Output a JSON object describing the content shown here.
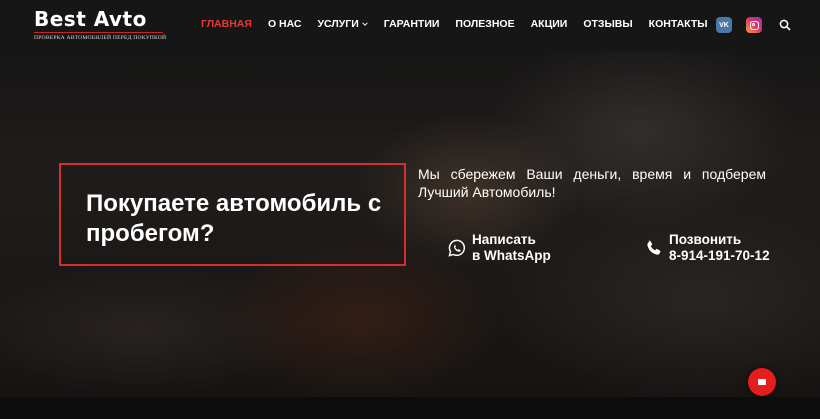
{
  "header": {
    "logo_title": "Best Avto",
    "logo_subtitle": "ПРОВЕРКА АВТОМОБИЛЕЙ ПЕРЕД ПОКУПКОЙ",
    "nav": [
      {
        "label": "ГЛАВНАЯ",
        "active": true
      },
      {
        "label": "О НАС"
      },
      {
        "label": "УСЛУГИ",
        "has_dropdown": true
      },
      {
        "label": "ГАРАНТИИ"
      },
      {
        "label": "ПОЛЕЗНОЕ"
      },
      {
        "label": "АКЦИИ"
      },
      {
        "label": "ОТЗЫВЫ"
      },
      {
        "label": "КОНТАКТЫ"
      }
    ],
    "vk_label": "VK",
    "icons": [
      "vk-icon",
      "instagram-icon",
      "search-icon"
    ]
  },
  "hero": {
    "headline": "Покупаете автомобиль с пробегом?",
    "tagline": "Мы сбережем Ваши деньги, время и подберем Лучший Автомобиль!",
    "whatsapp": {
      "line1": "Написать",
      "line2": "в WhatsApp"
    },
    "phone": {
      "line1": "Позвонить",
      "line2": "8-914-191-70-12"
    }
  },
  "colors": {
    "accent": "#e53935",
    "header_bg": "#161616",
    "chat_button": "#e51d1d",
    "vk": "#4a76a8"
  }
}
